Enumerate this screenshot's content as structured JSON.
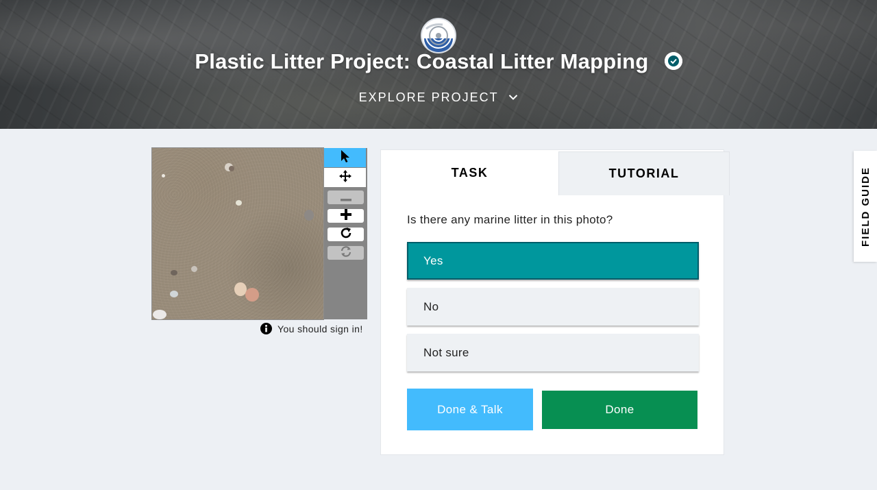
{
  "header": {
    "logo_icon": "project-logo-icon",
    "title": "Plastic Litter Project: Coastal Litter Mapping",
    "verified_icon": "verified-check-icon",
    "explore_label": "EXPLORE PROJECT",
    "explore_icon": "chevron-down-icon"
  },
  "viewer": {
    "tools": [
      {
        "name": "annotate",
        "icon": "pointer-icon",
        "active": true
      },
      {
        "name": "move",
        "icon": "move-icon",
        "active": false
      },
      {
        "name": "zoom-out",
        "icon": "minus-icon",
        "disabled": true
      },
      {
        "name": "zoom-in",
        "icon": "plus-icon",
        "disabled": false
      },
      {
        "name": "rotate",
        "icon": "rotate-icon",
        "disabled": false
      },
      {
        "name": "reset",
        "icon": "reset-icon",
        "disabled": true
      }
    ],
    "sign_in_notice": "You should sign in!"
  },
  "task_panel": {
    "tabs": [
      {
        "label": "TASK",
        "active": true
      },
      {
        "label": "TUTORIAL",
        "active": false
      }
    ],
    "question": "Is there any marine litter in this photo?",
    "answers": [
      {
        "label": "Yes",
        "selected": true
      },
      {
        "label": "No",
        "selected": false
      },
      {
        "label": "Not sure",
        "selected": false
      }
    ],
    "done_talk_label": "Done & Talk",
    "done_label": "Done"
  },
  "field_guide": {
    "label": "FIELD GUIDE"
  },
  "colors": {
    "selected_answer": "#00979d",
    "done_button": "#078f52",
    "done_talk_button": "#43bbfd",
    "active_tool": "#43bbfd",
    "page_background": "#edf0f4"
  }
}
